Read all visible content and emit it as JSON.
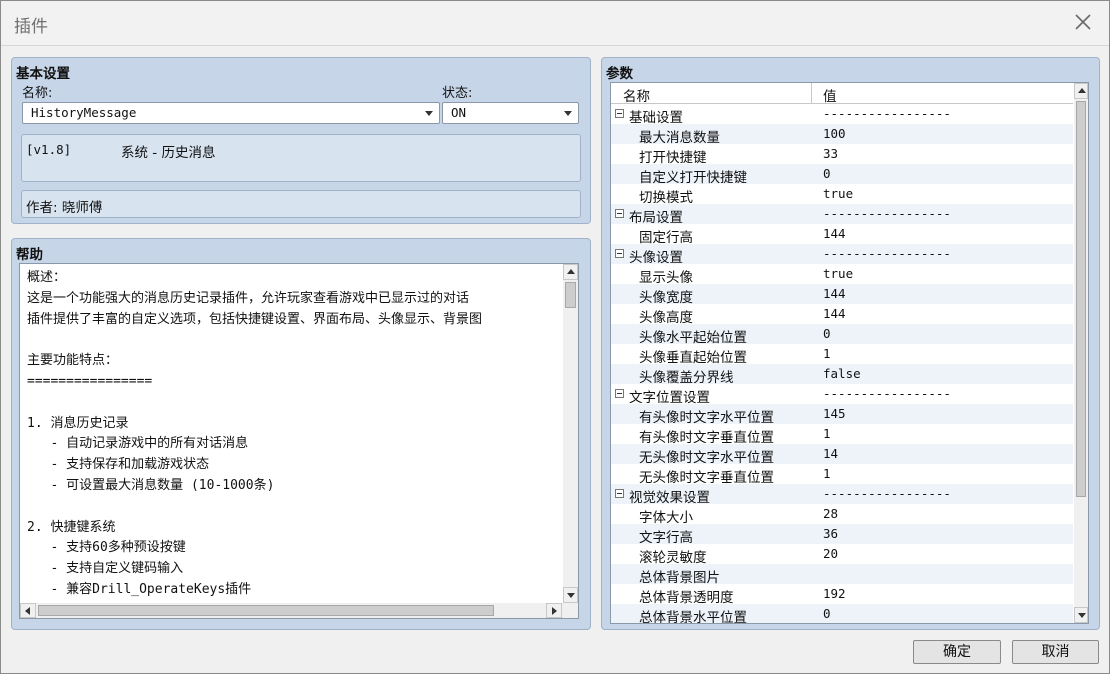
{
  "window": {
    "title": "插件"
  },
  "basic": {
    "section_title": "基本设置",
    "name_label": "名称:",
    "name_value": "HistoryMessage",
    "status_label": "状态:",
    "status_value": "ON",
    "version": "[v1.8]",
    "description": "系统 - 历史消息",
    "author": "作者: 晓师傅"
  },
  "help": {
    "section_title": "帮助",
    "lines": [
      "概述：",
      "这是一个功能强大的消息历史记录插件，允许玩家查看游戏中已显示过的对话",
      "插件提供了丰富的自定义选项，包括快捷键设置、界面布局、头像显示、背景图",
      "",
      "主要功能特点：",
      "================",
      "",
      "1. 消息历史记录",
      "   - 自动记录游戏中的所有对话消息",
      "   - 支持保存和加载游戏状态",
      "   - 可设置最大消息数量 (10-1000条)",
      "",
      "2. 快捷键系统",
      "   - 支持60多种预设按键",
      "   - 支持自定义键码输入",
      "   - 兼容Drill_OperateKeys插件"
    ]
  },
  "params": {
    "section_title": "参数",
    "col_name": "名称",
    "col_value": "值",
    "rows": [
      {
        "name": "基础设置",
        "value": "-----------------",
        "group": true
      },
      {
        "name": "最大消息数量",
        "value": "100"
      },
      {
        "name": "打开快捷键",
        "value": "33"
      },
      {
        "name": "自定义打开快捷键",
        "value": "0"
      },
      {
        "name": "切换模式",
        "value": "true"
      },
      {
        "name": "布局设置",
        "value": "-----------------",
        "group": true
      },
      {
        "name": "固定行高",
        "value": "144"
      },
      {
        "name": "头像设置",
        "value": "-----------------",
        "group": true
      },
      {
        "name": "显示头像",
        "value": "true"
      },
      {
        "name": "头像宽度",
        "value": "144"
      },
      {
        "name": "头像高度",
        "value": "144"
      },
      {
        "name": "头像水平起始位置",
        "value": "0"
      },
      {
        "name": "头像垂直起始位置",
        "value": "1"
      },
      {
        "name": "头像覆盖分界线",
        "value": "false"
      },
      {
        "name": "文字位置设置",
        "value": "-----------------",
        "group": true
      },
      {
        "name": "有头像时文字水平位置",
        "value": "145"
      },
      {
        "name": "有头像时文字垂直位置",
        "value": "1"
      },
      {
        "name": "无头像时文字水平位置",
        "value": "14"
      },
      {
        "name": "无头像时文字垂直位置",
        "value": "1"
      },
      {
        "name": "视觉效果设置",
        "value": "-----------------",
        "group": true
      },
      {
        "name": "字体大小",
        "value": "28"
      },
      {
        "name": "文字行高",
        "value": "36"
      },
      {
        "name": "滚轮灵敏度",
        "value": "20"
      },
      {
        "name": "总体背景图片",
        "value": ""
      },
      {
        "name": "总体背景透明度",
        "value": "192"
      },
      {
        "name": "总体背景水平位置",
        "value": "0"
      }
    ]
  },
  "buttons": {
    "ok": "确定",
    "cancel": "取消"
  }
}
